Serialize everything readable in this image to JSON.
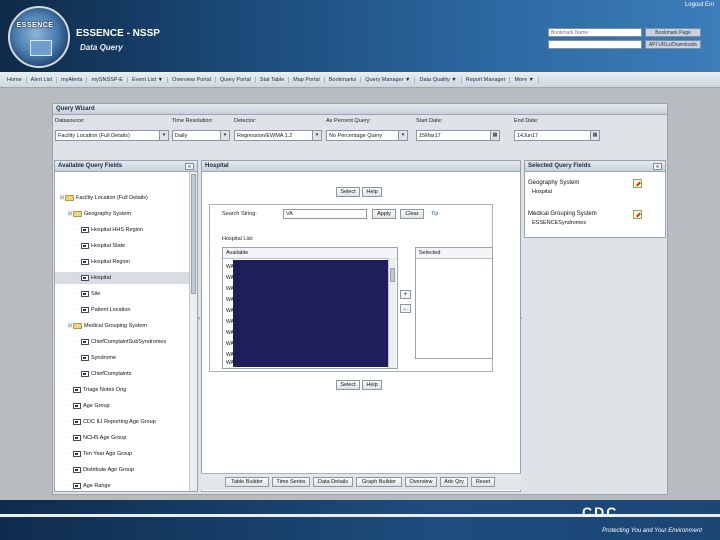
{
  "header": {
    "logo_text": "ESSENCE",
    "title": "ESSENCE - NSSP",
    "subtitle": "Data Query",
    "logout": "Logout Em",
    "bookmark_placeholder": "Bookmark Name",
    "btn_add_bookmark": "Bookmark Page",
    "btn_api_urls": "API URLs/Downloads"
  },
  "nav": {
    "items": [
      "Home",
      "Alert List",
      "myAlerts",
      "mySNSSP-E",
      "Event List ▼",
      "Overview Portal",
      "Query Portal",
      "Stat Table",
      "Map Portal",
      "Bookmarks",
      "Query Manager ▼",
      "Data Quality ▼",
      "Report Manager",
      "More ▼"
    ]
  },
  "wizard": {
    "title": "Query Wizard",
    "params": [
      {
        "label": "Datasource:",
        "value": "Facility Location (Full Details)"
      },
      {
        "label": "Time Resolution:",
        "value": "Daily"
      },
      {
        "label": "Detector:",
        "value": "Regression/EWMA 1.2"
      },
      {
        "label": "As Percent Query:",
        "value": "No Percentage Query"
      },
      {
        "label": "Start Date:",
        "value": "15Mar17"
      },
      {
        "label": "End Date:",
        "value": "14Jun17"
      }
    ]
  },
  "left_panel": {
    "title": "Available Query Fields",
    "collapse": "«",
    "tree": [
      {
        "label": "Facility Location (Full Details)",
        "icon": "folder"
      },
      {
        "label": "Geography System",
        "icon": "folder"
      },
      {
        "label": "Hospital HHS Region",
        "icon": "doc"
      },
      {
        "label": "Hospital State",
        "icon": "doc"
      },
      {
        "label": "Hospital Region",
        "icon": "doc"
      },
      {
        "label": "Hospital",
        "icon": "doc"
      },
      {
        "label": "Site",
        "icon": "doc"
      },
      {
        "label": "Patient Location",
        "icon": "doc"
      },
      {
        "label": "Medical Grouping System",
        "icon": "folder"
      },
      {
        "label": "ChiefComplaintSubSyndromes",
        "icon": "doc"
      },
      {
        "label": "Syndrome",
        "icon": "doc"
      },
      {
        "label": "ChiefComplaints",
        "icon": "doc"
      },
      {
        "label": "Triage Notes Orig",
        "icon": "doc"
      },
      {
        "label": "Age Group",
        "icon": "doc"
      },
      {
        "label": "CDC ILI Reporting Age Group",
        "icon": "doc"
      },
      {
        "label": "NCHS Age Group",
        "icon": "doc"
      },
      {
        "label": "Ten Year Age Group",
        "icon": "doc"
      },
      {
        "label": "Distribute Age Group",
        "icon": "doc"
      },
      {
        "label": "Age Range",
        "icon": "doc"
      }
    ]
  },
  "center_panel": {
    "title": "Hospital",
    "select_label": "Select",
    "help_label": "Help",
    "search_label": "Search String:",
    "search_value": "VA",
    "apply_label": "Apply",
    "clear_label": "Clear",
    "tip_label": "Tip",
    "list_label": "Hospital List:",
    "available_label": "Available",
    "selected_label": "Selected",
    "add_arrow": "+",
    "remove_arrow": "←",
    "wa_items": [
      "WA",
      "WA",
      "WA",
      "WA",
      "WA",
      "WA",
      "WA",
      "WA",
      "WA",
      "WA",
      "WA"
    ],
    "tabs": [
      "Table Builder",
      "Time Series",
      "Data Details",
      "Graph Builder",
      "Overview",
      "Adv Qry",
      "Reset"
    ]
  },
  "right_panel": {
    "title": "Selected Query Fields",
    "expand": "»",
    "groups": [
      {
        "heading": "Geography System",
        "value": "Hospital"
      },
      {
        "heading": "Medical Grouping System",
        "value": "ESSENCESyndromes"
      }
    ]
  },
  "footer": {
    "logo": "CDC",
    "tagline": "Protecting You and Your Environment"
  },
  "colors": {
    "header_dark": "#0e2a48",
    "header_light": "#3c7dba",
    "selection_dark": "#1e1e5c"
  }
}
